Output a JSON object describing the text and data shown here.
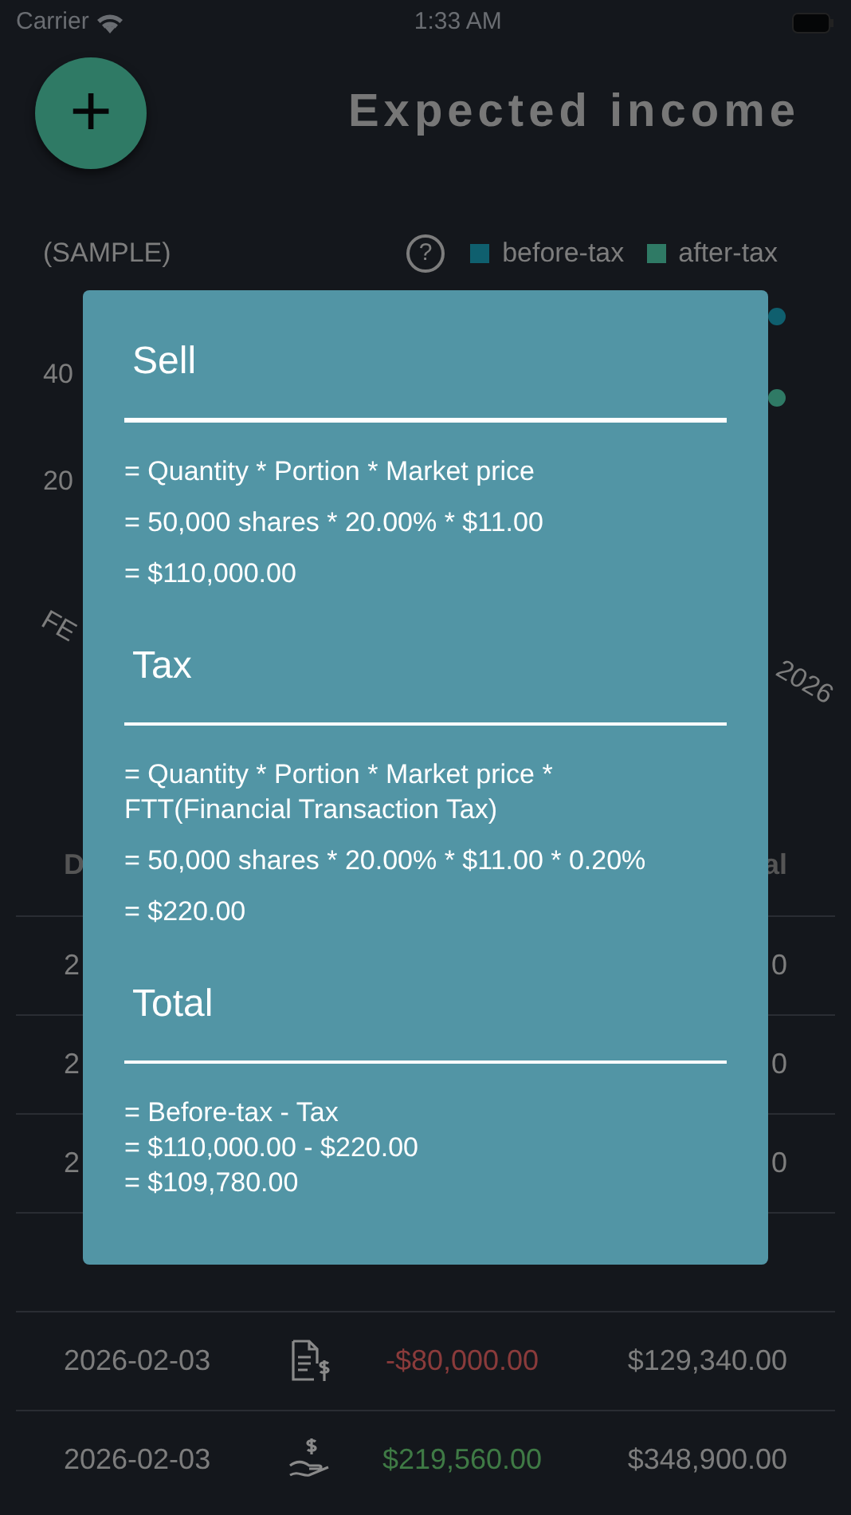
{
  "status_bar": {
    "carrier": "Carrier",
    "time": "1:33 AM"
  },
  "header": {
    "add_button": "+",
    "title": "Expected income"
  },
  "summary": {
    "label": "(SAMPLE)",
    "help": "?",
    "legend": [
      {
        "label": "before-tax",
        "color": "#0f5f6e"
      },
      {
        "label": "after-tax",
        "color": "#2f7a65"
      }
    ]
  },
  "chart_fragments": {
    "y_labels": [
      "40",
      "20"
    ],
    "x_labels": [
      "FE",
      "2026"
    ]
  },
  "table": {
    "columns": [
      "D",
      "al"
    ],
    "rows": [
      {
        "kind": "hidden",
        "date": "2",
        "total": "0"
      },
      {
        "kind": "hidden",
        "date": "2",
        "total": "0"
      },
      {
        "kind": "hidden",
        "date": "2",
        "total": "0"
      },
      {
        "kind": "covered"
      },
      {
        "kind": "expense",
        "date": "2026-02-03",
        "amount": "-$80,000.00",
        "total": "$129,340.00"
      },
      {
        "kind": "income",
        "date": "2026-02-03",
        "amount": "$219,560.00",
        "total": "$348,900.00"
      }
    ]
  },
  "dialog": {
    "sections": [
      {
        "title": "Sell",
        "compact": false,
        "lines": [
          "= Quantity * Portion * Market price",
          "= 50,000 shares * 20.00% * $11.00",
          "= $110,000.00"
        ]
      },
      {
        "title": "Tax",
        "compact": false,
        "lines": [
          "= Quantity * Portion * Market price * FTT(Financial Transaction Tax)",
          "= 50,000 shares * 20.00% * $11.00 * 0.20%",
          "= $220.00"
        ]
      },
      {
        "title": "Total",
        "compact": true,
        "lines": [
          "= Before-tax - Tax",
          "= $110,000.00 - $220.00",
          "= $109,780.00"
        ]
      }
    ]
  }
}
